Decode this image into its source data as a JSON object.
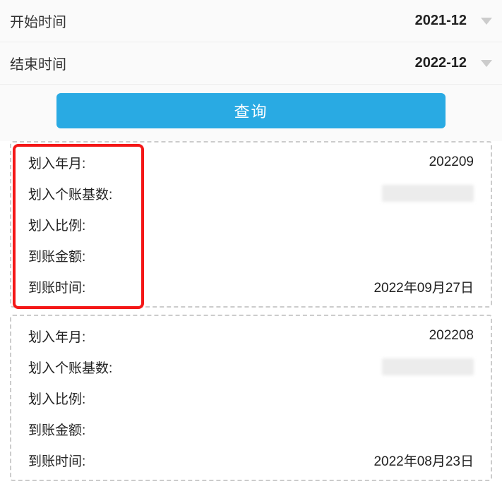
{
  "filters": {
    "start_label": "开始时间",
    "start_value": "2021-12",
    "end_label": "结束时间",
    "end_value": "2022-12"
  },
  "query_button": "查询",
  "labels": {
    "month": "划入年月:",
    "base": "划入个账基数:",
    "ratio": "划入比例:",
    "amount": "到账金额:",
    "arrive": "到账时间:"
  },
  "records": [
    {
      "month_value": "202209",
      "arrive_value": "2022年09月27日"
    },
    {
      "month_value": "202208",
      "arrive_value": "2022年08月23日"
    }
  ]
}
